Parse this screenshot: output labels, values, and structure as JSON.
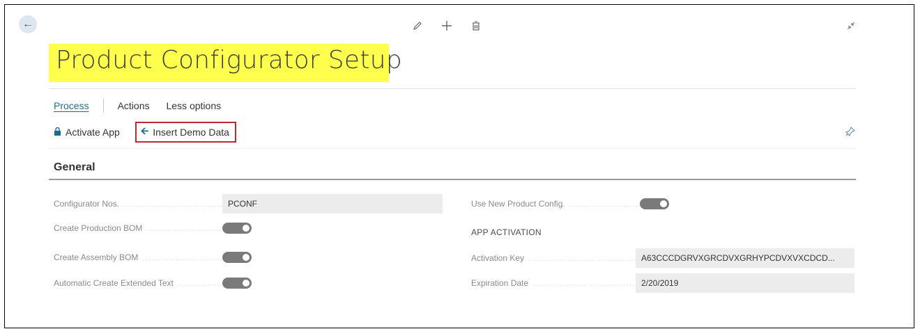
{
  "header": {
    "title": "Product Configurator Setup",
    "icons": [
      "back-arrow-icon",
      "edit-pencil-icon",
      "add-plus-icon",
      "delete-trash-icon",
      "collapse-arrows-icon"
    ]
  },
  "tabs": [
    {
      "label": "Process",
      "active": true
    },
    {
      "label": "Actions",
      "active": false
    },
    {
      "label": "Less options",
      "active": false
    }
  ],
  "commands": {
    "activate_label": "Activate App",
    "insert_demo_label": "Insert Demo Data"
  },
  "section": {
    "title": "General",
    "left_fields": [
      {
        "label": "Configurator Nos.",
        "value": "PCONF",
        "type": "text"
      },
      {
        "label": "Create Production BOM",
        "value": "on",
        "type": "toggle"
      },
      {
        "label": "Create Assembly BOM",
        "value": "on",
        "type": "toggle"
      },
      {
        "label": "Automatic Create Extended Text",
        "value": "on",
        "type": "toggle"
      }
    ],
    "right_fields": {
      "use_new": {
        "label": "Use New Product Config.",
        "value": "on",
        "type": "toggle"
      },
      "group_title": "APP ACTIVATION",
      "activation_key": {
        "label": "Activation Key",
        "value": "A63CCCDGRVXGRCDVXGRHYPCDVXVXCDCD..."
      },
      "expiration_date": {
        "label": "Expiration Date",
        "value": "2/20/2019"
      }
    }
  },
  "colors": {
    "accent": "#1f6a91",
    "highlight": "#ffff4d",
    "insert_border": "#c0282e"
  }
}
